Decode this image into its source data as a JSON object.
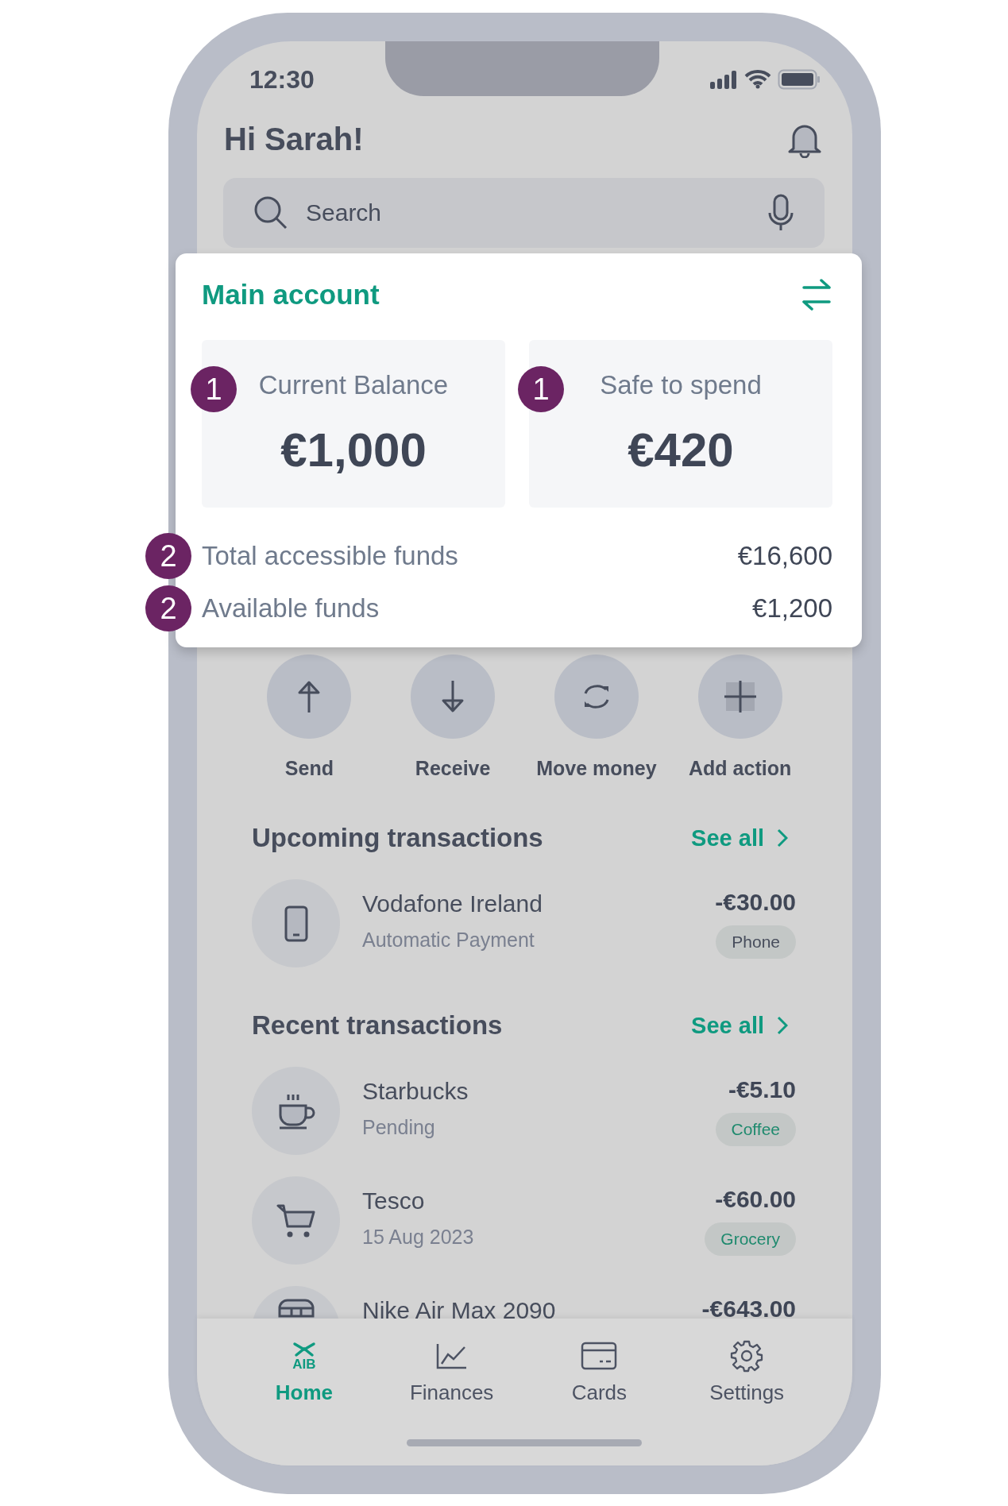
{
  "status_bar": {
    "time": "12:30"
  },
  "header": {
    "greeting": "Hi Sarah!"
  },
  "search": {
    "placeholder": "Search"
  },
  "account_card": {
    "title": "Main account",
    "balances": [
      {
        "badge": "1",
        "label": "Current Balance",
        "amount": "€1,000"
      },
      {
        "badge": "1",
        "label": "Safe to spend",
        "amount": "€420"
      }
    ],
    "funds": [
      {
        "badge": "2",
        "label": "Total accessible funds",
        "value": "€16,600"
      },
      {
        "badge": "2",
        "label": "Available funds",
        "value": "€1,200"
      }
    ]
  },
  "actions": [
    {
      "kind": "send",
      "label": "Send"
    },
    {
      "kind": "receive",
      "label": "Receive"
    },
    {
      "kind": "move",
      "label": "Move money"
    },
    {
      "kind": "add",
      "label": "Add action"
    }
  ],
  "upcoming": {
    "title": "Upcoming transactions",
    "link": "See all",
    "transactions": [
      {
        "kind": "phone",
        "name": "Vodafone Ireland",
        "detail": "Automatic Payment",
        "amount": "-€30.00",
        "tag": "Phone",
        "color": "#474d5c"
      }
    ]
  },
  "recent": {
    "title": "Recent transactions",
    "link": "See all",
    "transactions": [
      {
        "kind": "coffee",
        "name": "Starbucks",
        "detail": "Pending",
        "amount": "-€5.10",
        "tag": "Coffee",
        "color": "#1f8a6e"
      },
      {
        "kind": "cart",
        "name": "Tesco",
        "detail": "15 Aug 2023",
        "amount": "-€60.00",
        "tag": "Grocery",
        "color": "#1f8a6e"
      },
      {
        "kind": "shoe",
        "name": "Nike Air Max 2090",
        "amount": "-€643.00"
      }
    ]
  },
  "nav": [
    {
      "kind": "home",
      "logo": "AIB",
      "label": "Home",
      "selected": true
    },
    {
      "kind": "chart",
      "label": "Finances",
      "selected": false
    },
    {
      "kind": "card",
      "label": "Cards",
      "selected": false
    },
    {
      "kind": "gear",
      "label": "Settings",
      "selected": false
    }
  ]
}
